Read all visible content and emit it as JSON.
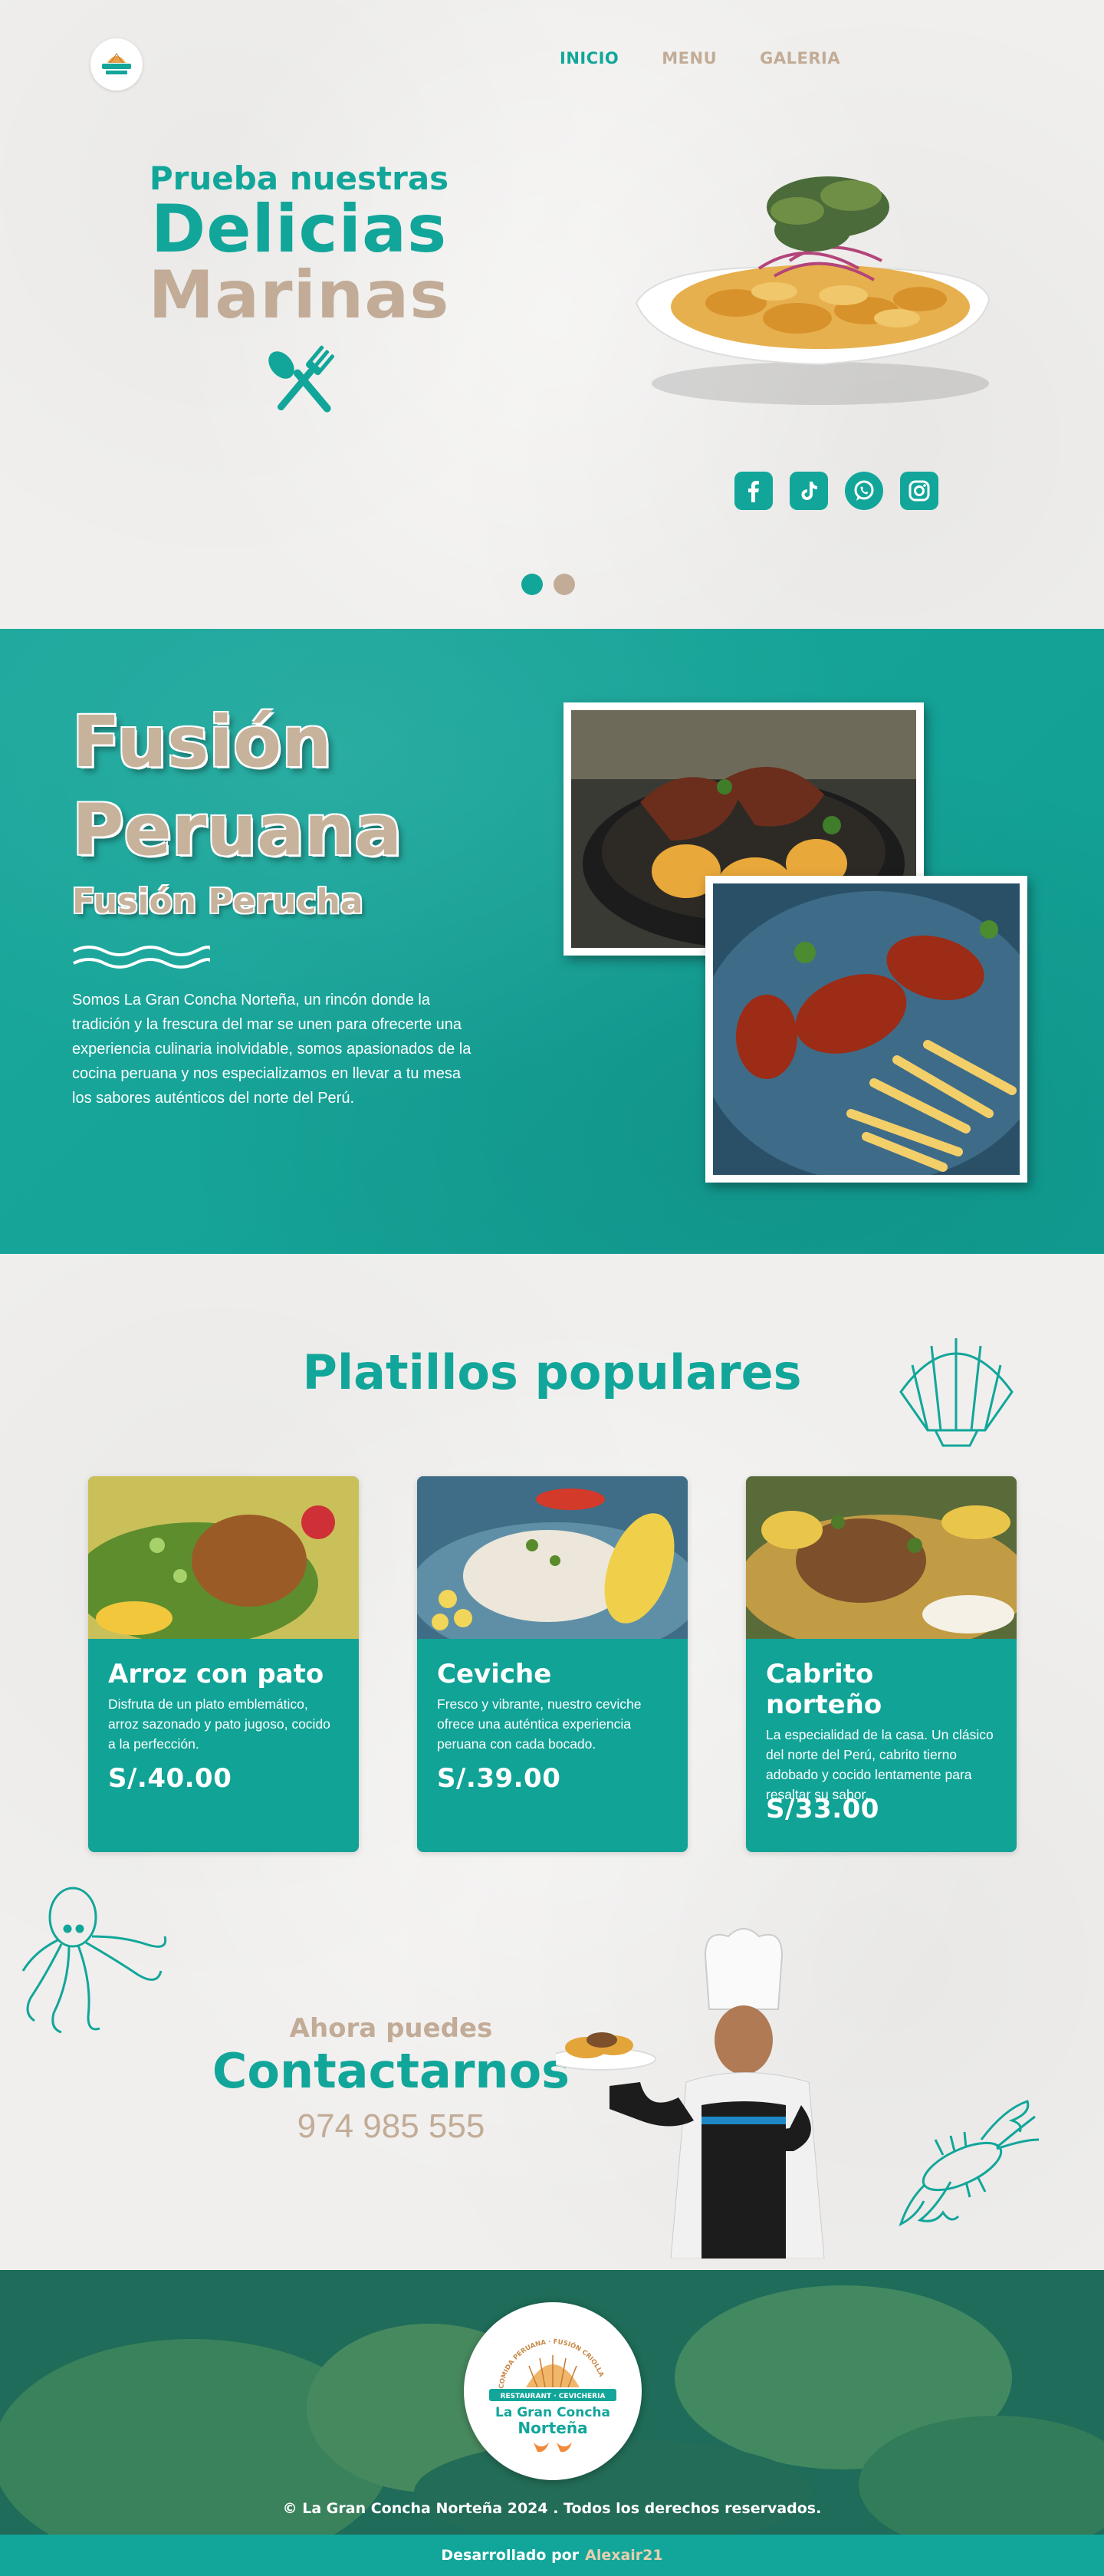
{
  "brand": {
    "name_line1": "La Gran",
    "name_line2": "Concha",
    "name_line3": "Norteña",
    "logo_ribbon": "RESTAURANT · CEVICHERIA",
    "logo_arc": "COMIDA PERUANA · FUSIÓN CRIOLLA"
  },
  "nav": {
    "items": [
      {
        "label": "INICIO",
        "active": true
      },
      {
        "label": "MENU",
        "active": false
      },
      {
        "label": "GALERIA",
        "active": false
      }
    ]
  },
  "hero": {
    "kicker": "Prueba nuestras",
    "line1": "Delicias",
    "line2": "Marinas",
    "utensils_icon": "fork-spoon-icon",
    "slides": 2,
    "active_slide": 1,
    "socials": [
      {
        "icon": "facebook-icon"
      },
      {
        "icon": "tiktok-icon"
      },
      {
        "icon": "whatsapp-icon"
      },
      {
        "icon": "instagram-icon"
      }
    ]
  },
  "fusion": {
    "title_line1": "Fusión",
    "title_line2": "Peruana",
    "subtitle": "Fusión  Perucha",
    "body": "Somos  La Gran Concha Norteña, un rincón donde la tradición y la frescura del mar se unen para ofrecerte una experiencia culinaria inolvidable, somos apasionados de la cocina peruana y nos especializamos en llevar a tu mesa los sabores auténticos del norte del Perú."
  },
  "popular": {
    "title": "Platillos populares",
    "dishes": [
      {
        "name": "Arroz con pato",
        "desc": "Disfruta de un plato emblemático, arroz sazonado y pato jugoso, cocido a la perfección.",
        "price": "S/.40.00"
      },
      {
        "name": "Ceviche",
        "desc": "Fresco y vibrante, nuestro ceviche ofrece una auténtica experiencia peruana con cada bocado.",
        "price": "S/.39.00"
      },
      {
        "name": "Cabrito norteño",
        "desc": "La especialidad de la casa. Un clásico del norte del Perú, cabrito tierno adobado y cocido lentamente para resaltar su sabor.",
        "price": "S/33.00"
      }
    ]
  },
  "contact": {
    "kicker": "Ahora puedes",
    "title": "Contactarnos",
    "phone": "974 985 555"
  },
  "footer": {
    "copyright": "© La Gran Concha Norteña 2024 . Todos los derechos reservados.",
    "dev_prefix": "Desarrollado por",
    "dev_author": "Alexair21"
  },
  "colors": {
    "teal": "#12a69a",
    "beige": "#c2ac97",
    "paper": "#f0efed"
  }
}
